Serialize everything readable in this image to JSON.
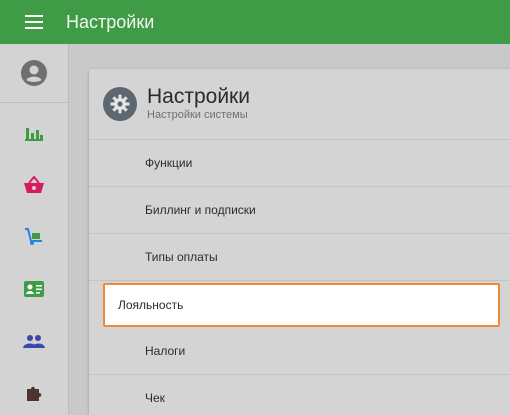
{
  "topbar": {
    "menu_icon": "hamburger-menu-icon",
    "title": "Настройки"
  },
  "sidebar": {
    "avatar_icon": "account-circle-icon",
    "items": [
      {
        "icon": "bar-chart-icon",
        "color": "#3f9b45"
      },
      {
        "icon": "shopping-basket-icon",
        "color": "#d81b60"
      },
      {
        "icon": "hand-truck-icon",
        "color": "#1e88e5"
      },
      {
        "icon": "contact-card-icon",
        "color": "#3f9b45"
      },
      {
        "icon": "people-icon",
        "color": "#3949ab"
      },
      {
        "icon": "puzzle-icon",
        "color": "#4e342e"
      }
    ]
  },
  "panel": {
    "icon": "gear-icon",
    "title": "Настройки",
    "subtitle": "Настройки системы",
    "items": [
      {
        "label": "Функции",
        "selected": false
      },
      {
        "label": "Биллинг и подписки",
        "selected": false
      },
      {
        "label": "Типы оплаты",
        "selected": false
      },
      {
        "label": "Лояльность",
        "selected": true
      },
      {
        "label": "Налоги",
        "selected": false
      },
      {
        "label": "Чек",
        "selected": false
      }
    ]
  },
  "colors": {
    "topbar": "#3f9b45",
    "selection_border": "#ee8a3c"
  }
}
